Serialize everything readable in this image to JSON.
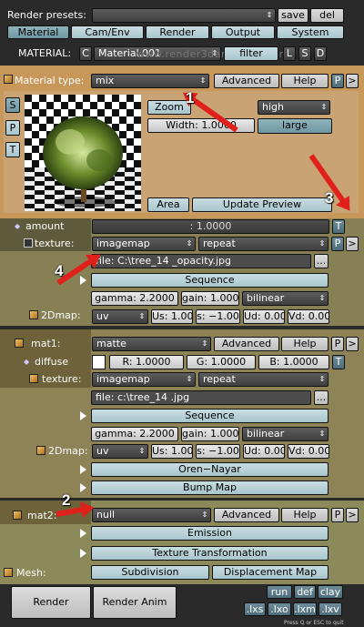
{
  "header": {
    "render_presets_label": "Render presets:",
    "save": "save",
    "del": "del",
    "tabs": [
      "Material",
      "Cam/Env",
      "Render",
      "Output",
      "System"
    ],
    "material_label": "MATERIAL:",
    "c_btn": "C",
    "material_name": "Material.001",
    "filter": "filter",
    "l": "L",
    "s": "S",
    "d": "D",
    "watermark": "www.render3darchitect.com"
  },
  "mat_type": {
    "label": "Material type:",
    "value": "mix",
    "advanced": "Advanced",
    "help": "Help",
    "p": "P",
    "arrow": ">"
  },
  "preview": {
    "side_btns": [
      "S",
      "P",
      "T"
    ],
    "zoom": "Zoom",
    "width": "Width: 1.0000",
    "quality": "high",
    "large": "large",
    "area": "Area",
    "update": "Update Preview"
  },
  "amount": {
    "label": "amount",
    "value": ": 1.0000",
    "t": "T"
  },
  "texture1": {
    "label": "texture:",
    "type": "imagemap",
    "mode": "repeat",
    "p": "P",
    "arrow": ">",
    "file": "file: C:\\tree_14 _opacity.jpg",
    "ellipsis": "...",
    "sequence": "Sequence",
    "gamma": "gamma: 2.2000",
    "gain": "gain: 1.000",
    "filter": "bilinear",
    "map_label": "2Dmap:",
    "uv": "uv",
    "us": "Us: 1.00",
    "s": "s: −1.00",
    "ud": "Ud: 0.00",
    "vd": "Vd: 0.00"
  },
  "mat1": {
    "label": "mat1:",
    "value": "matte",
    "advanced": "Advanced",
    "help": "Help",
    "p": "P",
    "arrow": ">",
    "diffuse_label": "diffuse",
    "r": "R: 1.0000",
    "g": "G: 1.0000",
    "b": "B: 1.0000",
    "t": "T",
    "texture_label": "texture:",
    "tex_type": "imagemap",
    "tex_mode": "repeat",
    "file": "file: c:\\tree_14 .jpg",
    "ellipsis": "...",
    "sequence": "Sequence",
    "gamma": "gamma: 2.2000",
    "gain": "gain: 1.000",
    "filter": "bilinear",
    "map_label": "2Dmap:",
    "uv": "uv",
    "us": "Us: 1.00",
    "s": "s: −1.00",
    "ud": "Ud: 0.00",
    "vd": "Vd: 0.00",
    "oren": "Oren−Nayar",
    "bump": "Bump Map"
  },
  "mat2": {
    "label": "mat2:",
    "value": "null",
    "advanced": "Advanced",
    "help": "Help",
    "p": "P",
    "arrow": ">",
    "emission": "Emission",
    "tex_transform": "Texture Transformation",
    "mesh_label": "Mesh:",
    "subdivision": "Subdivision",
    "displacement": "Displacement Map"
  },
  "footer": {
    "render": "Render",
    "render_anim": "Render Anim",
    "run": "run",
    "def": "def",
    "clay": "clay",
    "lxs": ".lxs",
    "lxo": ".lxo",
    "lxm": ".lxm",
    "lxv": ".lxv",
    "hint": "Press Q or ESC to quit"
  },
  "annotations": [
    "1",
    "2",
    "3",
    "4"
  ],
  "colors": {
    "orange_panel": "#c8975a",
    "olive_panel": "#8a7d3c",
    "mat_panel": "#6c5a2e",
    "header_bg": "#2a2a2a",
    "teal_button": "#a9c6cd",
    "red_arrow": "#e0201a"
  }
}
